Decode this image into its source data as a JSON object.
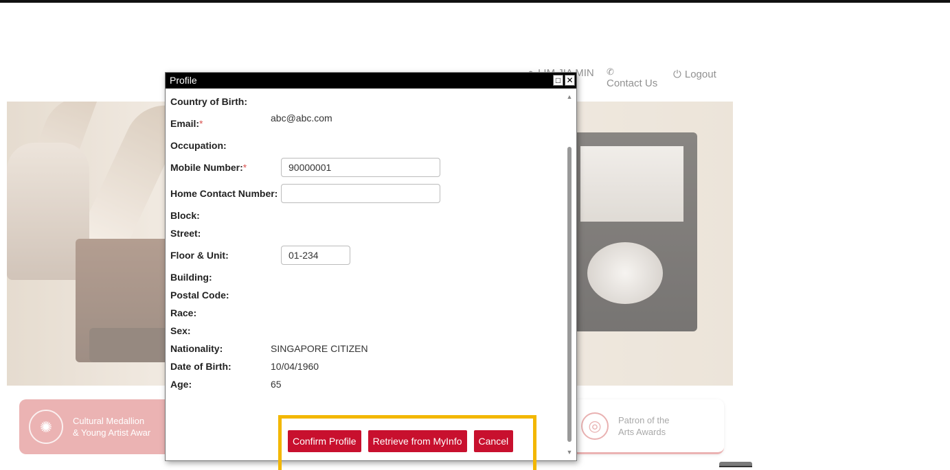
{
  "header": {
    "user_name": "LIM JIA MIN",
    "contact_label": "Contact Us",
    "logout_label": "Logout"
  },
  "cards": {
    "left_title_line1": "Cultural Medallion",
    "left_title_line2": "& Young Artist Awar",
    "right_title_line1": "Patron of the",
    "right_title_line2": "Arts Awards"
  },
  "dialog": {
    "title": "Profile",
    "fields": {
      "country_of_birth": {
        "label": "Country of Birth:",
        "value": ""
      },
      "email": {
        "label": "Email:",
        "required": "*",
        "value": "abc@abc.com"
      },
      "occupation": {
        "label": "Occupation:",
        "value": ""
      },
      "mobile": {
        "label": "Mobile Number:",
        "required": "*",
        "value": "90000001"
      },
      "home_contact": {
        "label": "Home Contact Number:",
        "value": ""
      },
      "block": {
        "label": "Block:",
        "value": ""
      },
      "street": {
        "label": "Street:",
        "value": ""
      },
      "floor_unit": {
        "label": "Floor & Unit:",
        "value": "01-234"
      },
      "building": {
        "label": "Building:",
        "value": ""
      },
      "postal_code": {
        "label": "Postal Code:",
        "value": ""
      },
      "race": {
        "label": "Race:",
        "value": ""
      },
      "sex": {
        "label": "Sex:",
        "value": ""
      },
      "nationality": {
        "label": "Nationality:",
        "value": "SINGAPORE CITIZEN"
      },
      "dob": {
        "label": "Date of Birth:",
        "value": "10/04/1960"
      },
      "age": {
        "label": "Age:",
        "value": "65"
      }
    },
    "buttons": {
      "confirm": "Confirm Profile",
      "retrieve": "Retrieve from MyInfo",
      "cancel": "Cancel"
    }
  },
  "colors": {
    "primary_button": "#c8102e",
    "highlight": "#f3b700",
    "card_accent": "#e08a8a"
  }
}
